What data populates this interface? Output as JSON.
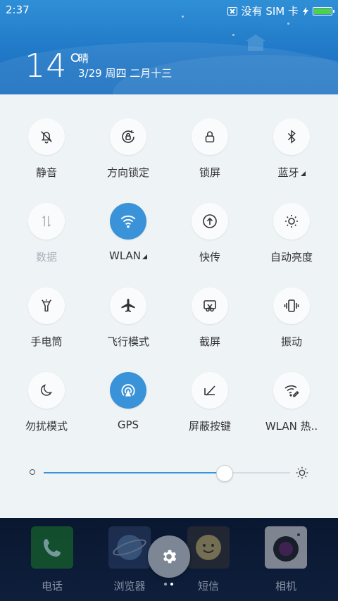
{
  "status_bar": {
    "time": "2:37",
    "sim_text": "没有 SIM 卡"
  },
  "weather": {
    "temperature": "14°",
    "condition": "晴",
    "date": "3/29 周四 二月十三"
  },
  "tiles": [
    {
      "label": "静音",
      "icon": "bell-off-icon",
      "active": false
    },
    {
      "label": "方向锁定",
      "icon": "rotation-lock-icon",
      "active": false
    },
    {
      "label": "锁屏",
      "icon": "lock-icon",
      "active": false
    },
    {
      "label": "蓝牙",
      "icon": "bluetooth-icon",
      "active": false
    },
    {
      "label": "数据",
      "icon": "mobile-data-icon",
      "active": false
    },
    {
      "label": "WLAN",
      "icon": "wifi-icon",
      "active": true
    },
    {
      "label": "快传",
      "icon": "upload-icon",
      "active": false
    },
    {
      "label": "自动亮度",
      "icon": "brightness-icon",
      "active": false
    },
    {
      "label": "手电筒",
      "icon": "flashlight-icon",
      "active": false
    },
    {
      "label": "飞行模式",
      "icon": "airplane-icon",
      "active": false
    },
    {
      "label": "截屏",
      "icon": "screenshot-icon",
      "active": false
    },
    {
      "label": "振动",
      "icon": "vibrate-icon",
      "active": false
    },
    {
      "label": "勿扰模式",
      "icon": "moon-icon",
      "active": false
    },
    {
      "label": "GPS",
      "icon": "gps-icon",
      "active": true
    },
    {
      "label": "屏蔽按键",
      "icon": "block-keys-icon",
      "active": false
    },
    {
      "label": "WLAN 热..",
      "icon": "hotspot-icon",
      "active": false
    }
  ],
  "brightness": {
    "level": 0.73
  },
  "dock": [
    {
      "label": "电话",
      "icon": "phone-icon"
    },
    {
      "label": "浏览器",
      "icon": "browser-icon"
    },
    {
      "label": "短信",
      "icon": "message-icon"
    },
    {
      "label": "相机",
      "icon": "camera-icon"
    }
  ],
  "colors": {
    "accent": "#3a93d8",
    "header": "#1f77c6"
  }
}
